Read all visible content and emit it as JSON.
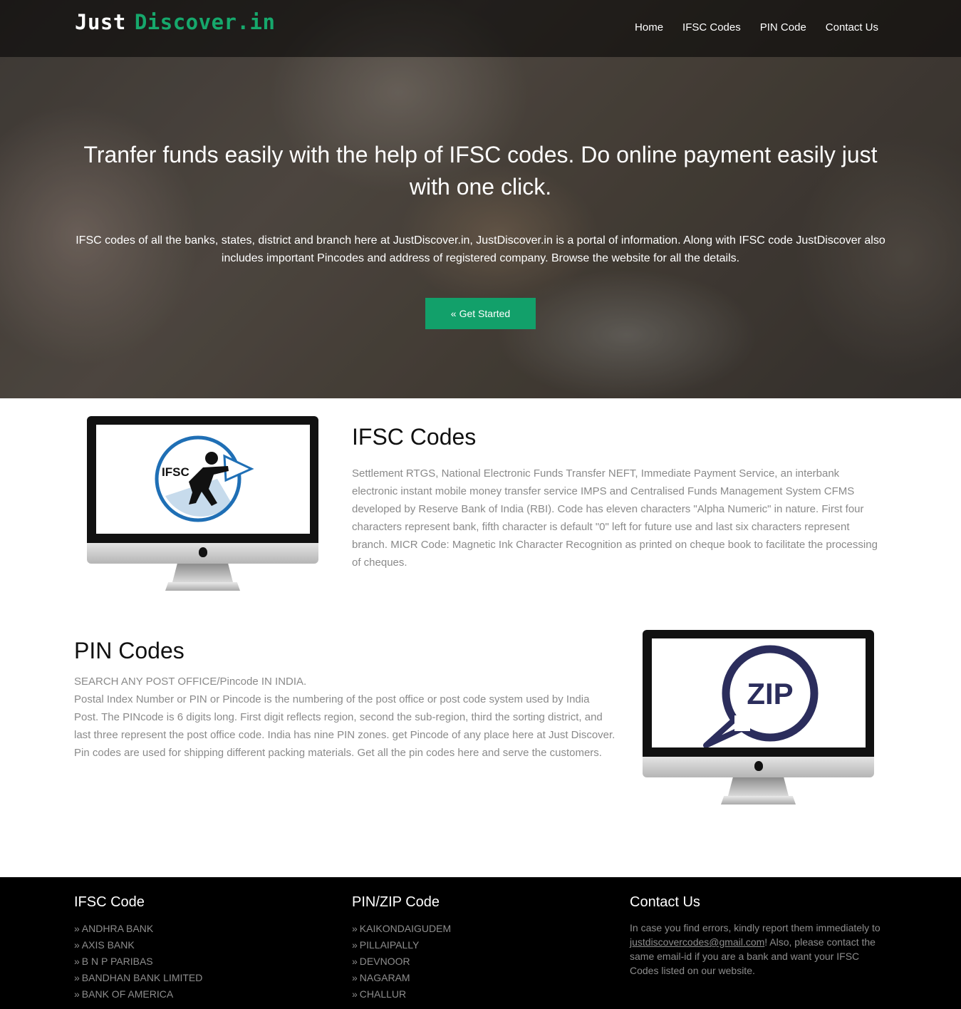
{
  "brand": {
    "word1": "Just",
    "word2": "Discover.in"
  },
  "nav": [
    "Home",
    "IFSC Codes",
    "PIN Code",
    "Contact Us"
  ],
  "hero": {
    "title": "Tranfer funds easily with the help of IFSC codes. Do online payment easily just with one click.",
    "description": "IFSC codes of all the banks, states, district and branch here at JustDiscover.in, JustDiscover.in is a portal of information. Along with IFSC code JustDiscover also includes important Pincodes and address of registered company. Browse the website for all the details.",
    "button_icon": "«",
    "button_label": "Get Started"
  },
  "ifsc_section": {
    "image_label": "IFSC",
    "title": "IFSC Codes",
    "text": "Settlement RTGS, National Electronic Funds Transfer NEFT, Immediate Payment Service, an interbank electronic instant mobile money transfer service IMPS and Centralised Funds Management System CFMS developed by Reserve Bank of India (RBI). Code has eleven characters \"Alpha Numeric\" in nature. First four characters represent bank, fifth character is default \"0\" left for future use and last six characters represent branch. MICR Code: Magnetic Ink Character Recognition as printed on cheque book to facilitate the processing of cheques."
  },
  "pin_section": {
    "image_label": "ZIP",
    "title": "PIN Codes",
    "subtitle": "SEARCH ANY POST OFFICE/Pincode IN INDIA.",
    "text": "Postal Index Number or PIN or Pincode is the numbering of the post office or post code system used by India Post. The PINcode is 6 digits long. First digit reflects region, second the sub-region, third the sorting district, and last three represent the post office code. India has nine PIN zones. get Pincode of any place here at Just Discover. Pin codes are used for shipping different packing materials. Get all the pin codes here and serve the customers."
  },
  "footer": {
    "ifsc": {
      "title": "IFSC Code",
      "items": [
        "ANDHRA BANK",
        "AXIS BANK",
        "B N P PARIBAS",
        "BANDHAN BANK LIMITED",
        "BANK OF AMERICA"
      ]
    },
    "pin": {
      "title": "PIN/ZIP Code",
      "items": [
        "KAIKONDAIGUDEM",
        "PILLAIPALLY",
        "DEVNOOR",
        "NAGARAM",
        "CHALLUR"
      ]
    },
    "contact": {
      "title": "Contact Us",
      "text_before": "In case you find errors, kindly report them immediately to ",
      "email": "justdiscovercodes@gmail.com",
      "text_after": "! Also, please contact the same email-id if you are a bank and want your IFSC Codes listed on our website."
    },
    "arrow": "»"
  },
  "colors": {
    "accent": "#12a06a",
    "brand_green": "#16a86c",
    "footer_bg": "#000000",
    "zip_navy": "#2b2d5c",
    "ifsc_blue": "#1f6fb5"
  }
}
